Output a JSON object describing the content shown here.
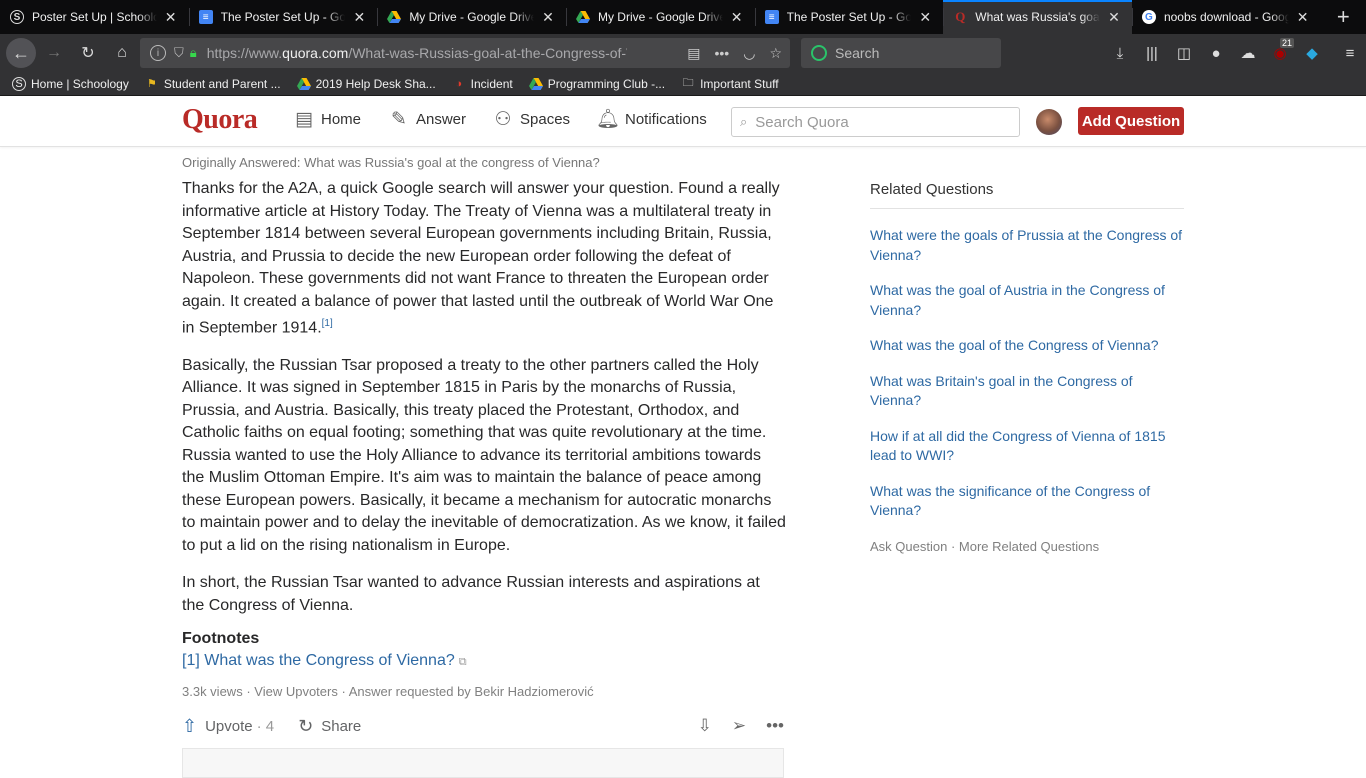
{
  "browser": {
    "tabs": [
      {
        "title": "Poster Set Up | Schoology",
        "favicon": "schoology-icon",
        "active": false
      },
      {
        "title": "The Poster Set Up - Google Docs",
        "favicon": "docs-icon",
        "active": false
      },
      {
        "title": "My Drive - Google Drive",
        "favicon": "drive-icon",
        "active": false
      },
      {
        "title": "My Drive - Google Drive",
        "favicon": "drive-icon",
        "active": false
      },
      {
        "title": "The Poster Set Up - Google Docs",
        "favicon": "docs-icon",
        "active": false
      },
      {
        "title": "What was Russia's goal at the Congress",
        "favicon": "quora-icon",
        "active": true
      },
      {
        "title": "noobs download - Google Search",
        "favicon": "google-icon",
        "active": false
      }
    ],
    "url_prefix": "https://www.",
    "url_domain": "quora.com",
    "url_path": "/What-was-Russias-goal-at-the-Congress-of-Vienna",
    "search_placeholder": "Search",
    "notification_count": "21",
    "bookmarks": [
      {
        "label": "Home | Schoology",
        "icon": "schoology-icon"
      },
      {
        "label": "Student and Parent ...",
        "icon": "flag-icon"
      },
      {
        "label": "2019 Help Desk Sha...",
        "icon": "drive-icon"
      },
      {
        "label": "Incident",
        "icon": "incident-icon"
      },
      {
        "label": "Programming Club -...",
        "icon": "drive-icon"
      },
      {
        "label": "Important Stuff",
        "icon": "folder-icon"
      }
    ]
  },
  "quora": {
    "logo": "Quora",
    "nav": [
      {
        "label": "Home",
        "icon": "home-icon"
      },
      {
        "label": "Answer",
        "icon": "answer-icon"
      },
      {
        "label": "Spaces",
        "icon": "spaces-icon"
      },
      {
        "label": "Notifications",
        "icon": "bell-icon"
      }
    ],
    "search_placeholder": "Search Quora",
    "add_question": "Add Question",
    "brand_color": "#b92b27",
    "link_color": "#2e69a3"
  },
  "answer": {
    "originally_answered": "Originally Answered: What was Russia's goal at the congress of Vienna?",
    "paragraphs": [
      "Thanks for the A2A, a quick Google search will answer your question. Found a really informative article at History Today. The Treaty of Vienna was a multilateral treaty in September 1814 between several European governments including Britain, Russia, Austria, and Prussia to decide the new European order following the defeat of Napoleon. These governments did not want France to threaten the European order again. It created a balance of power that lasted until the outbreak of World War One in September 1914.",
      "Basically, the Russian Tsar proposed a treaty to the other partners called the Holy Alliance. It was signed in September 1815 in Paris by the monarchs of Russia, Prussia, and Austria. Basically, this treaty placed the Protestant, Orthodox, and Catholic faiths on equal footing; something that was quite revolutionary at the time. Russia wanted to use the Holy Alliance to advance its territorial ambitions towards the Muslim Ottoman Empire. It's aim was to maintain the balance of peace among these European powers. Basically, it became a mechanism for autocratic monarchs to maintain power and to delay the inevitable of democratization. As we know, it failed to put a lid on the rising nationalism in Europe.",
      "In short, the Russian Tsar wanted to advance Russian interests and aspirations at the Congress of Vienna."
    ],
    "citation": "[1]",
    "footnotes_heading": "Footnotes",
    "footnote": "[1] What was the Congress of Vienna?",
    "views": "3.3k views",
    "view_upvoters": "View Upvoters",
    "requested_by": "Answer requested by Bekir Hadziomerović",
    "upvote_label": "Upvote",
    "upvote_count": "4",
    "share_label": "Share"
  },
  "sidebar": {
    "heading": "Related Questions",
    "questions": [
      "What were the goals of Prussia at the Congress of Vienna?",
      "What was the goal of Austria in the Congress of Vienna?",
      "What was the goal of the Congress of Vienna?",
      "What was Britain's goal in the Congress of Vienna?",
      "How if at all did the Congress of Vienna of 1815 lead to WWI?",
      "What was the significance of the Congress of Vienna?"
    ],
    "ask_question": "Ask Question",
    "more_related": "More Related Questions"
  }
}
